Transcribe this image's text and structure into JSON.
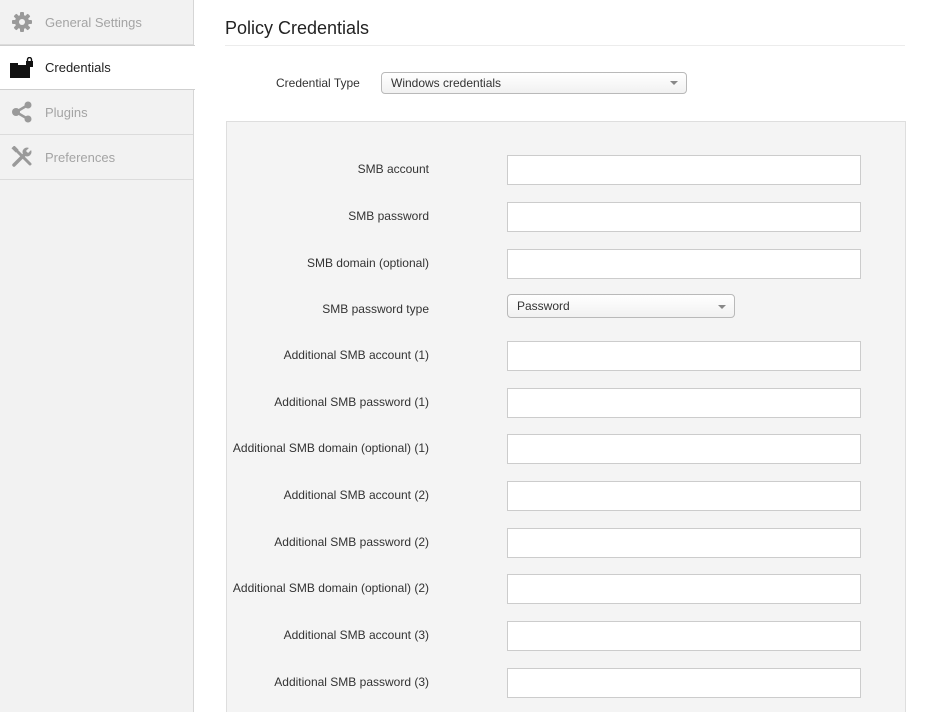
{
  "sidebar": {
    "items": [
      {
        "label": "General Settings",
        "icon": "gear-icon",
        "active": false
      },
      {
        "label": "Credentials",
        "icon": "briefcase-lock-icon",
        "active": true
      },
      {
        "label": "Plugins",
        "icon": "share-icon",
        "active": false
      },
      {
        "label": "Preferences",
        "icon": "tools-icon",
        "active": false
      }
    ]
  },
  "main": {
    "title": "Policy Credentials",
    "credential_type": {
      "label": "Credential Type",
      "value": "Windows credentials"
    },
    "fields": [
      {
        "label": "SMB account",
        "value": ""
      },
      {
        "label": "SMB password",
        "value": ""
      },
      {
        "label": "SMB domain (optional)",
        "value": ""
      },
      {
        "label": "SMB password type",
        "value": "Password"
      },
      {
        "label": "Additional SMB account (1)",
        "value": ""
      },
      {
        "label": "Additional SMB password (1)",
        "value": ""
      },
      {
        "label": "Additional SMB domain (optional) (1)",
        "value": ""
      },
      {
        "label": "Additional SMB account (2)",
        "value": ""
      },
      {
        "label": "Additional SMB password (2)",
        "value": ""
      },
      {
        "label": "Additional SMB domain (optional) (2)",
        "value": ""
      },
      {
        "label": "Additional SMB account (3)",
        "value": ""
      },
      {
        "label": "Additional SMB password (3)",
        "value": ""
      }
    ]
  }
}
